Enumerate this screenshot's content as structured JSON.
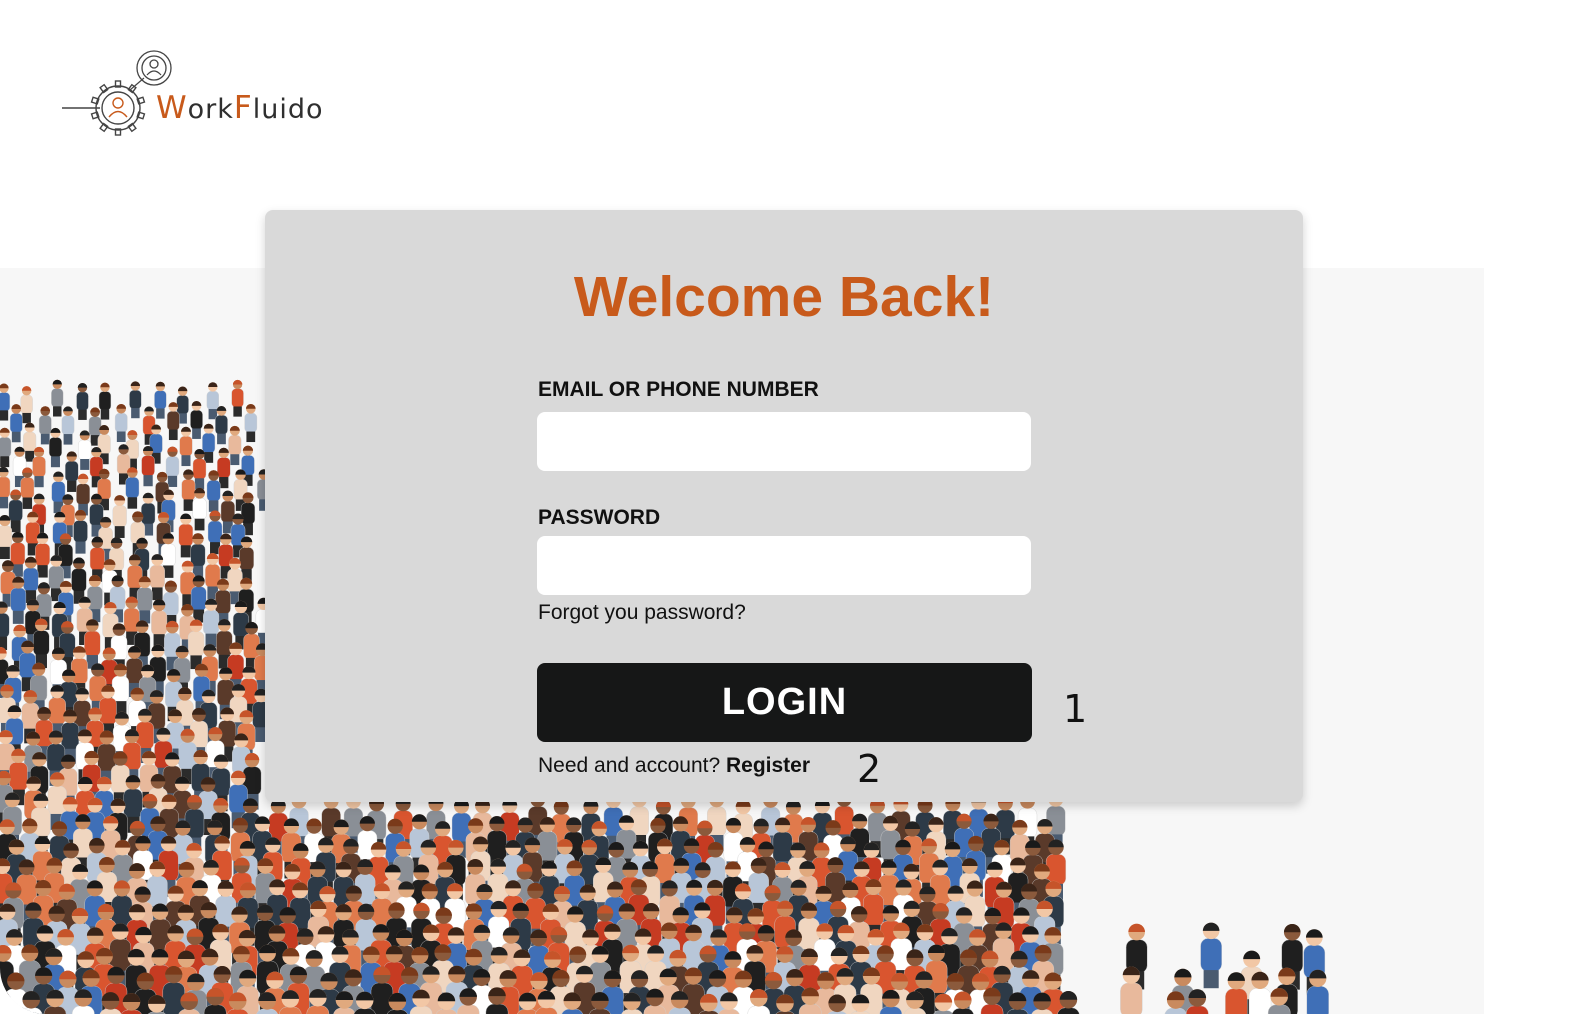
{
  "brand": {
    "name_part1_initial": "W",
    "name_part1_rest": "ork",
    "name_part2_initial": "F",
    "name_part2_rest": "luido",
    "accent_color": "#c85a1b"
  },
  "login": {
    "title": "Welcome Back!",
    "email_label": "EMAIL OR PHONE NUMBER",
    "email_value": "",
    "password_label": "PASSWORD",
    "password_value": "",
    "forgot_link": "Forgot you password?",
    "login_button": "LOGIN",
    "register_prompt": "Need and account?",
    "register_link": "Register"
  },
  "annotations": {
    "marker_1": "1",
    "marker_2": "2"
  },
  "colors": {
    "card_background": "#d9d9d9",
    "button_background": "#161717",
    "title_color": "#c85a1b"
  },
  "icons": [
    "gear-icon",
    "user-icon"
  ]
}
